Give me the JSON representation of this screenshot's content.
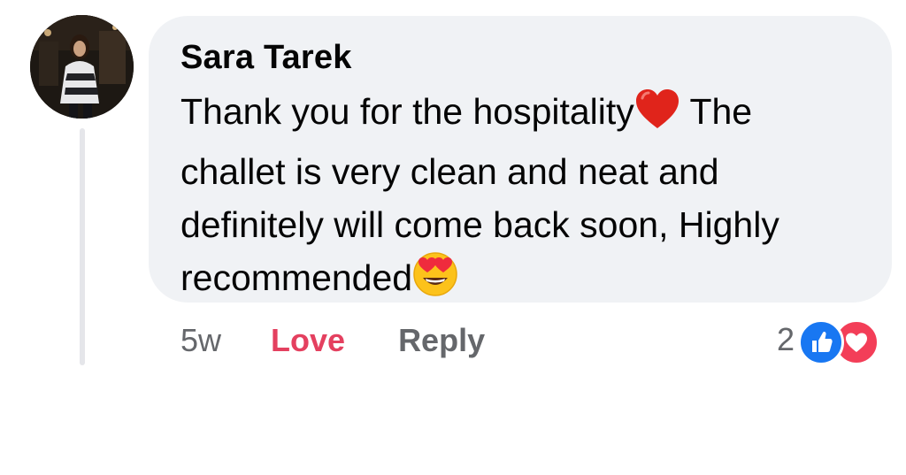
{
  "comment": {
    "author": "Sara Tarek",
    "lines": [
      "Thank you for the hospitality",
      "The challet is very clean and neat and definitely will come back soon,",
      "Highly recommended"
    ],
    "emojis": [
      "red-heart-emoji",
      "heart-eyes-emoji"
    ]
  },
  "actions": {
    "time": "5w",
    "love": "Love",
    "reply": "Reply"
  },
  "reactions": {
    "count": "2",
    "types": [
      "like",
      "love"
    ],
    "colors": {
      "like": "#1877f2",
      "love": "#f33e58"
    }
  },
  "colors": {
    "bubble": "#f0f2f5",
    "love_label": "#e4405f",
    "meta_text": "#65676b",
    "text": "#050505"
  }
}
